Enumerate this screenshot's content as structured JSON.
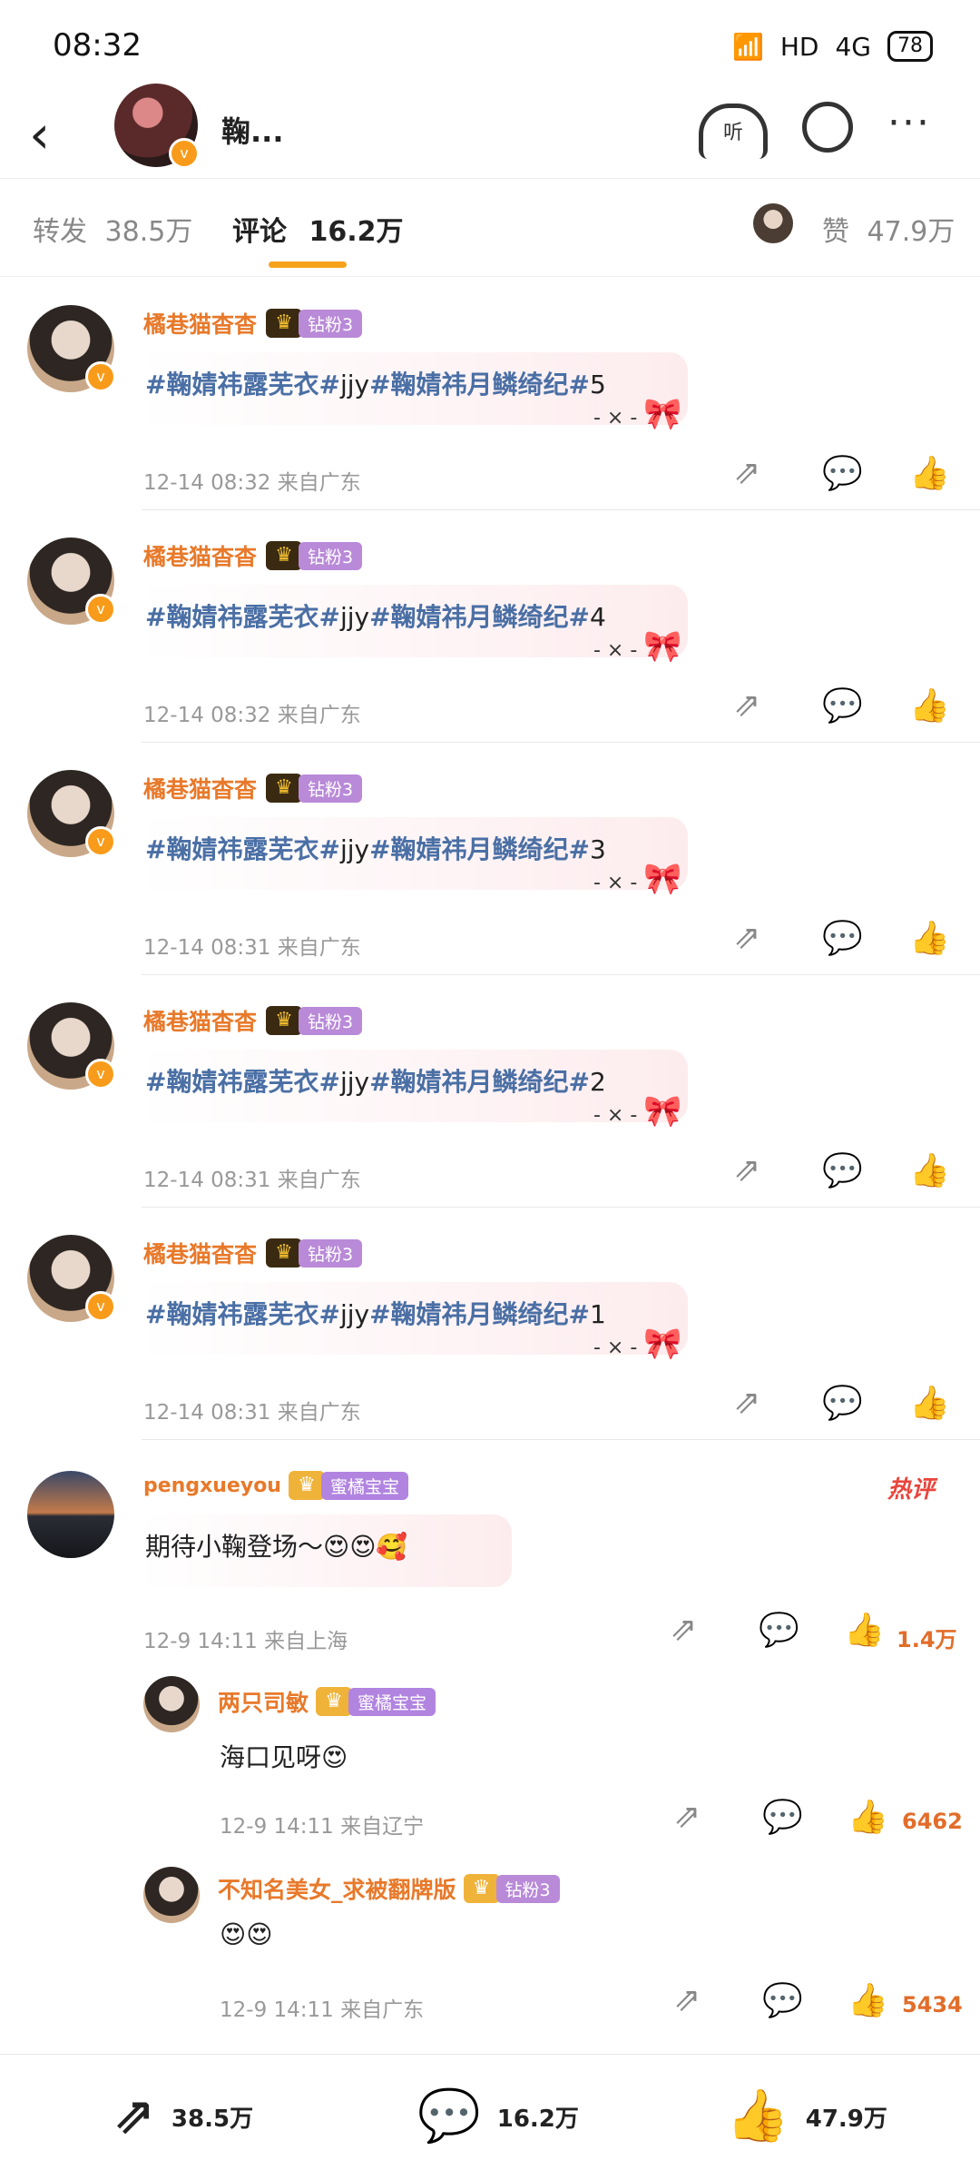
{
  "status_bar": {
    "time": "08:32",
    "network": "HD",
    "signal": "4G",
    "battery": "78"
  },
  "header": {
    "title": "鞠..."
  },
  "tabs": [
    {
      "label": "转发",
      "count": "38.5万"
    },
    {
      "label": "评论",
      "count": "16.2万"
    },
    {
      "label": "赞",
      "count": "47.9万"
    }
  ],
  "comments": [
    {
      "user": "橘巷猫杳杳",
      "badge": "钻粉3",
      "tag1": "#鞠婧祎露芜衣#",
      "mid": "jjy",
      "tag2": "#鞠婧祎月鳞绮纪#",
      "suffix": "5",
      "time": "12-14 08:32 来自广东"
    },
    {
      "user": "橘巷猫杳杳",
      "badge": "钻粉3",
      "tag1": "#鞠婧祎露芜衣#",
      "mid": "jjy",
      "tag2": "#鞠婧祎月鳞绮纪#",
      "suffix": "4",
      "time": "12-14 08:32 来自广东"
    },
    {
      "user": "橘巷猫杳杳",
      "badge": "钻粉3",
      "tag1": "#鞠婧祎露芜衣#",
      "mid": "jjy",
      "tag2": "#鞠婧祎月鳞绮纪#",
      "suffix": "3",
      "time": "12-14 08:31 来自广东"
    },
    {
      "user": "橘巷猫杳杳",
      "badge": "钻粉3",
      "tag1": "#鞠婧祎露芜衣#",
      "mid": "jjy",
      "tag2": "#鞠婧祎月鳞绮纪#",
      "suffix": "2",
      "time": "12-14 08:31 来自广东"
    },
    {
      "user": "橘巷猫杳杳",
      "badge": "钻粉3",
      "tag1": "#鞠婧祎露芜衣#",
      "mid": "jjy",
      "tag2": "#鞠婧祎月鳞绮纪#",
      "suffix": "1",
      "time": "12-14 08:31 来自广东"
    }
  ],
  "hot_comment": {
    "user": "pengxueyou",
    "badge": "蜜橘宝宝",
    "hot_label": "热评",
    "text": "期待小鞠登场～😍😍🥰",
    "time": "12-9 14:11 来自上海",
    "likes": "1.4万"
  },
  "replies": [
    {
      "user": "两只司敏",
      "badge": "蜜橘宝宝",
      "text": "海口见呀😍",
      "time": "12-9 14:11 来自辽宁",
      "likes": "6462"
    },
    {
      "user": "不知名美女_求被翻牌版",
      "badge": "钻粉3",
      "text": "😍😍",
      "time": "12-9 14:11 来自广东",
      "likes": "5434"
    }
  ],
  "bottom_bar": {
    "repost": "38.5万",
    "comment": "16.2万",
    "like": "47.9万"
  },
  "colors": {
    "accent": "#f7a21b",
    "username": "#e8792a",
    "topic": "#4a6fa5",
    "hot": "#e8453c"
  }
}
